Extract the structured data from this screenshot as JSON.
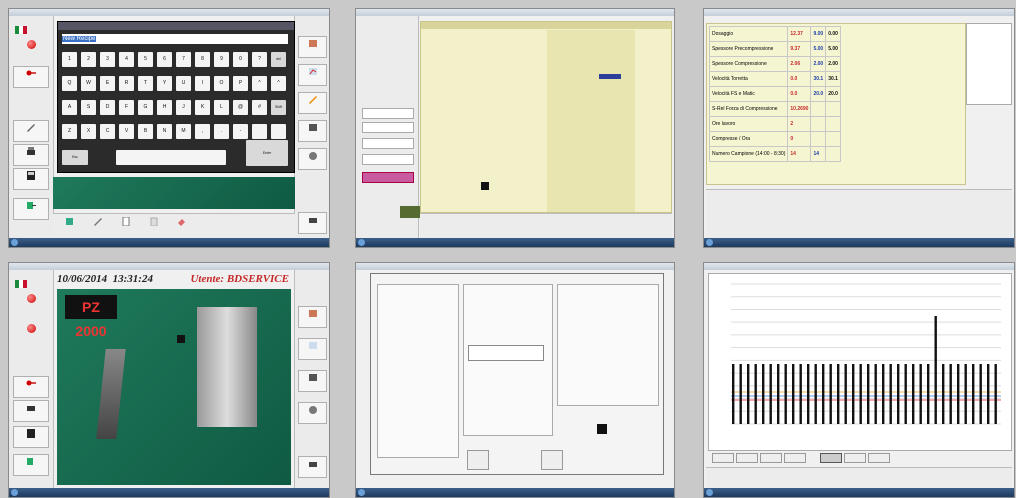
{
  "panels": {
    "keyboard": {
      "input_value": "New Recipe",
      "rows": [
        [
          "1",
          "2",
          "3",
          "4",
          "5",
          "6",
          "7",
          "8",
          "9",
          "0",
          "?",
          "del"
        ],
        [
          "Q",
          "W",
          "E",
          "R",
          "T",
          "Y",
          "U",
          "I",
          "O",
          "P",
          "^",
          "^"
        ],
        [
          "A",
          "S",
          "D",
          "F",
          "G",
          "H",
          "J",
          "K",
          "L",
          "@",
          "#",
          "Shift"
        ],
        [
          "Z",
          "X",
          "C",
          "V",
          "B",
          "N",
          "M",
          ",",
          ".",
          "-",
          "",
          ""
        ]
      ],
      "space_key": "",
      "enter_key": "Enter",
      "esc_key": "Esc"
    },
    "main": {
      "date": "10/06/2014",
      "time": "13:31:24",
      "user_label": "Utente: BDSERVICE",
      "logo": "PZ 2000"
    },
    "production": {
      "rows": [
        {
          "label": "Dosaggio",
          "red": "12.37",
          "blue": "9.00",
          "black": "0.00"
        },
        {
          "label": "Spessore Precompressione",
          "red": "9.37",
          "blue": "5.00",
          "black": "5.00"
        },
        {
          "label": "Spessore Compressione",
          "red": "2.06",
          "blue": "2.00",
          "black": "2.00"
        },
        {
          "label": "Velocità Torretta",
          "red": "0.0",
          "blue": "30.1",
          "black": "30.1"
        },
        {
          "label": "Velocità FS e Matic",
          "red": "0.0",
          "blue": "20.0",
          "black": "20.0"
        },
        {
          "label": "S-Rel Forza di Compressione",
          "red": "10.2690",
          "blue": "",
          "black": ""
        },
        {
          "label": "Ore lavoro",
          "red": "2",
          "blue": "",
          "black": ""
        },
        {
          "label": "Compresse / Ora",
          "red": "0",
          "blue": "",
          "black": ""
        },
        {
          "label": "Numero Campione (14:00 - 8:30)",
          "red": "14",
          "blue": "14",
          "black": ""
        }
      ]
    }
  },
  "colors": {
    "accent_red": "#c62828",
    "accent_blue": "#1a3ea8",
    "machine_green": "#1f7a5b"
  }
}
